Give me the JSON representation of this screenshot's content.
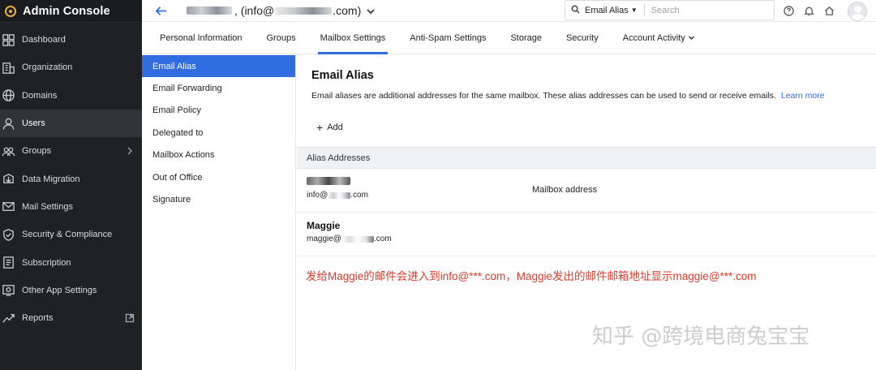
{
  "app": {
    "title": "Admin Console"
  },
  "sidebar": {
    "items": [
      {
        "label": "Dashboard",
        "icon": "dashboard-icon"
      },
      {
        "label": "Organization",
        "icon": "organization-icon"
      },
      {
        "label": "Domains",
        "icon": "globe-icon"
      },
      {
        "label": "Users",
        "icon": "user-icon",
        "active": true
      },
      {
        "label": "Groups",
        "icon": "groups-icon",
        "has_submenu": true
      },
      {
        "label": "Data Migration",
        "icon": "migration-icon"
      },
      {
        "label": "Mail Settings",
        "icon": "mail-settings-icon"
      },
      {
        "label": "Security & Compliance",
        "icon": "shield-icon"
      },
      {
        "label": "Subscription",
        "icon": "subscription-icon"
      },
      {
        "label": "Other App Settings",
        "icon": "app-settings-icon"
      },
      {
        "label": "Reports",
        "icon": "reports-icon",
        "external": true
      }
    ]
  },
  "topbar": {
    "account_prefix": ", (info@",
    "account_suffix": ".com)",
    "search_scope": "Email Alias",
    "search_placeholder": "Search"
  },
  "tabs": [
    {
      "label": "Personal Information"
    },
    {
      "label": "Groups"
    },
    {
      "label": "Mailbox Settings",
      "active": true
    },
    {
      "label": "Anti-Spam Settings"
    },
    {
      "label": "Storage"
    },
    {
      "label": "Security"
    },
    {
      "label": "Account Activity",
      "dropdown": true
    }
  ],
  "subnav": [
    {
      "label": "Email Alias",
      "active": true
    },
    {
      "label": "Email Forwarding"
    },
    {
      "label": "Email Policy"
    },
    {
      "label": "Delegated to"
    },
    {
      "label": "Mailbox Actions"
    },
    {
      "label": "Out of Office"
    },
    {
      "label": "Signature"
    }
  ],
  "content": {
    "title": "Email Alias",
    "description": "Email aliases are additional addresses for the same mailbox. These alias addresses can be used to send or receive emails.",
    "learn_more": "Learn more",
    "add_label": "Add",
    "table_header": "Alias Addresses",
    "rows": [
      {
        "name": "",
        "email_prefix": "info@",
        "email_suffix": ".com",
        "tag": "Mailbox address"
      },
      {
        "name": "Maggie",
        "email_prefix": "maggie@",
        "email_suffix": ".com",
        "tag": ""
      }
    ],
    "annotation": "发给Maggie的邮件会进入到info@***.com，Maggie发出的邮件邮箱地址显示maggie@***.com",
    "annotation_color": "#e0392b"
  },
  "watermark": "知乎 @跨境电商兔宝宝",
  "colors": {
    "accent": "#2f6de1",
    "sidebar_bg": "#1f2125"
  }
}
